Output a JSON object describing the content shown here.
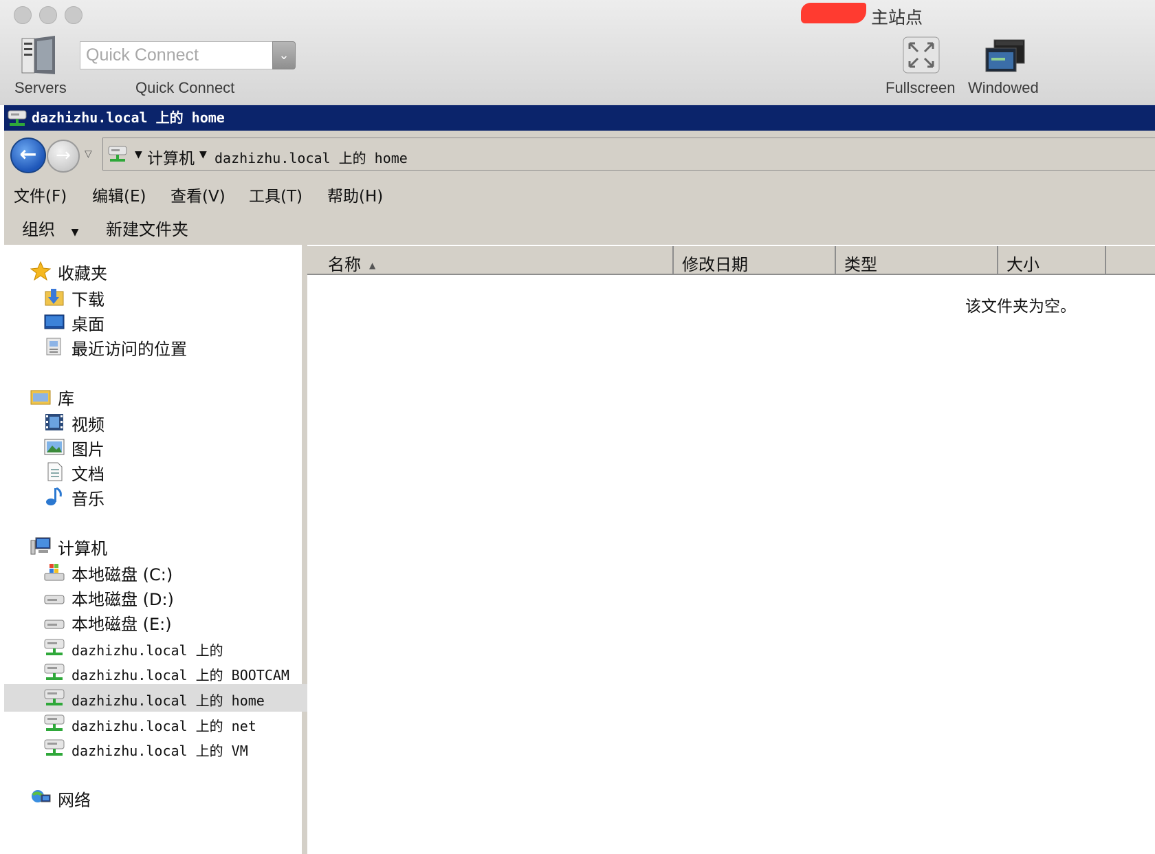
{
  "mac_window": {
    "title": "主站点",
    "toolbar": {
      "servers_label": "Servers",
      "quick_connect_placeholder": "Quick Connect",
      "quick_connect_label": "Quick Connect",
      "fullscreen_label": "Fullscreen",
      "windowed_label": "Windowed"
    }
  },
  "explorer": {
    "caption": "dazhizhu.local 上的 home",
    "address": {
      "computer": "计算机",
      "location": "dazhizhu.local 上的 home"
    },
    "menu": [
      "文件(F)",
      "编辑(E)",
      "查看(V)",
      "工具(T)",
      "帮助(H)"
    ],
    "commands": {
      "organize": "组织",
      "new_folder": "新建文件夹"
    },
    "nav": {
      "favorites": {
        "title": "收藏夹",
        "items": [
          "下载",
          "桌面",
          "最近访问的位置"
        ]
      },
      "libraries": {
        "title": "库",
        "items": [
          "视频",
          "图片",
          "文档",
          "音乐"
        ]
      },
      "computer": {
        "title": "计算机",
        "drives": [
          "本地磁盘 (C:)",
          "本地磁盘 (D:)",
          "本地磁盘 (E:)"
        ],
        "shares": [
          "dazhizhu.local 上的",
          "dazhizhu.local 上的 BOOTCAM",
          "dazhizhu.local 上的 home",
          "dazhizhu.local 上的 net",
          "dazhizhu.local 上的 VM"
        ],
        "selected_share": "dazhizhu.local 上的 home"
      },
      "network": {
        "title": "网络"
      }
    },
    "columns": [
      "名称",
      "修改日期",
      "类型",
      "大小"
    ],
    "empty_message": "该文件夹为空。"
  },
  "colors": {
    "caption_bar": "#0b246b",
    "chrome": "#d4d0c8",
    "selected_row": "#dcdcdc",
    "redaction": "#ff3b30"
  }
}
